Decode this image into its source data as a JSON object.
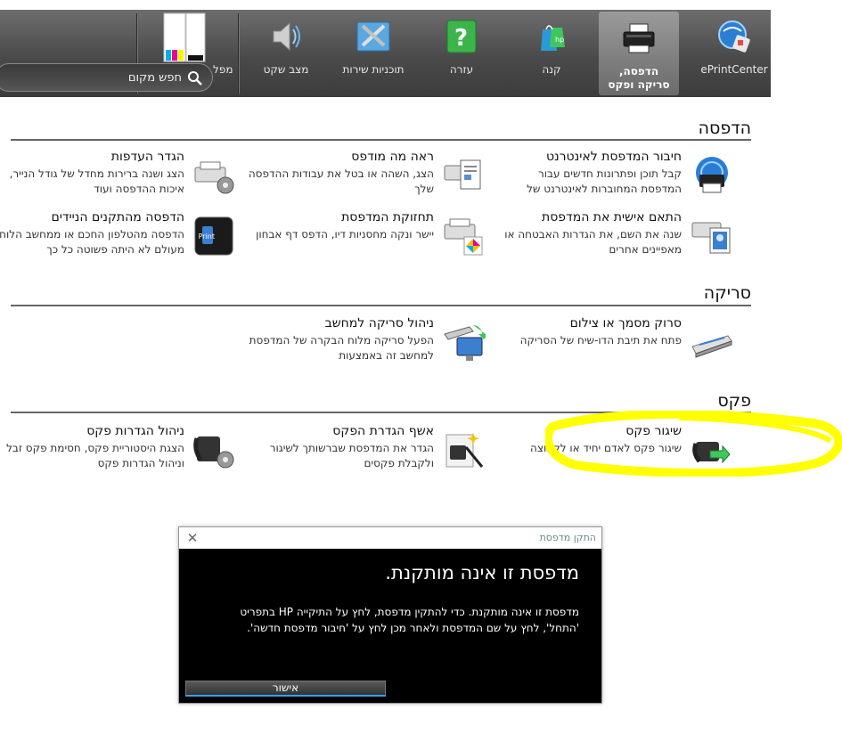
{
  "toolbar": {
    "items": [
      {
        "label": "ePrintCenter",
        "icon": "eprint-center-icon"
      },
      {
        "label": "הדפסה, סריקה ופקס",
        "icon": "printer-icon",
        "active": true
      },
      {
        "label": "קנה",
        "icon": "shopping-bag-icon"
      },
      {
        "label": "עזרה",
        "icon": "help-icon"
      },
      {
        "label": "תוכניות שירות",
        "icon": "tools-icon"
      },
      {
        "label": "מצב שקט",
        "icon": "speaker-icon"
      }
    ],
    "fragment_label": "מפל",
    "ink_colors": [
      "#00aeef",
      "#ec008c",
      "#fff200",
      "#111111"
    ]
  },
  "search": {
    "placeholder": "חפש מקום"
  },
  "sections": {
    "print": {
      "title": "הדפסה",
      "tasks": [
        {
          "title": "חיבור המדפסת לאינטרנט",
          "desc": "קבל תוכן ופתרונות חדשים עבור המדפסת המחוברות לאינטרנט של",
          "icon": "web-printer-icon"
        },
        {
          "title": "ראה מה מודפס",
          "desc": "הצג, השהה או בטל את עבודות ההדפסה שלך",
          "icon": "print-queue-icon"
        },
        {
          "title": "הגדר העדפות",
          "desc": "הצג ושנה ברירות מחדל של גודל הנייר, איכות ההדפסה ועוד",
          "icon": "printer-settings-icon"
        },
        {
          "title": "התאם אישית את המדפסת",
          "desc": "שנה את השם, את הגדרות האבטחה או מאפיינים אחרים",
          "icon": "printer-customize-icon"
        },
        {
          "title": "תחזוקת המדפסת",
          "desc": "יישר ונקה מחסניות דיו, הדפס דף אבחון",
          "icon": "printer-maintenance-icon"
        },
        {
          "title": "הדפסה מהתקנים הניידים",
          "desc": "הדפסה מהטלפון החכם או ממחשב הלוח מעולם לא היתה פשוטה כל כך",
          "icon": "mobile-print-icon"
        }
      ]
    },
    "scan": {
      "title": "סריקה",
      "tasks": [
        {
          "title": "סרוק מסמך או צילום",
          "desc": "פתח את תיבת הדו-שיח של הסריקה",
          "icon": "scanner-icon"
        },
        {
          "title": "ניהול סריקה למחשב",
          "desc": "הפעל סריקה מלוח הבקרה של המדפסת למחשב זה באמצעות",
          "icon": "scan-to-computer-icon"
        }
      ]
    },
    "fax": {
      "title": "פקס",
      "tasks": [
        {
          "title": "שיגור פקס",
          "desc": "שיגור פקס לאדם יחיד או לקבוצה",
          "icon": "send-fax-icon"
        },
        {
          "title": "אשף הגדרת הפקס",
          "desc": "הגדר את המדפסת שברשותך לשיגור ולקבלת פקסים",
          "icon": "fax-wizard-icon"
        },
        {
          "title": "ניהול הגדרות פקס",
          "desc": "הצגת היסטוריית פקס, חסימת פקס זבל וניהול הגדרות פקס",
          "icon": "fax-settings-icon"
        }
      ]
    }
  },
  "highlight_color": "#ffff00",
  "dialog": {
    "title": "התקן מדפסת",
    "close": "✕",
    "heading": "מדפסת זו אינה מותקנת.",
    "body": "מדפסת זו אינה מותקנת. כדי להתקין מדפסת, לחץ על התיקייה HP בתפריט 'התחל', לחץ על שם המדפסת ולאחר מכן לחץ על 'חיבור מדפסת חדשה'.",
    "ok_label": "אישור"
  }
}
